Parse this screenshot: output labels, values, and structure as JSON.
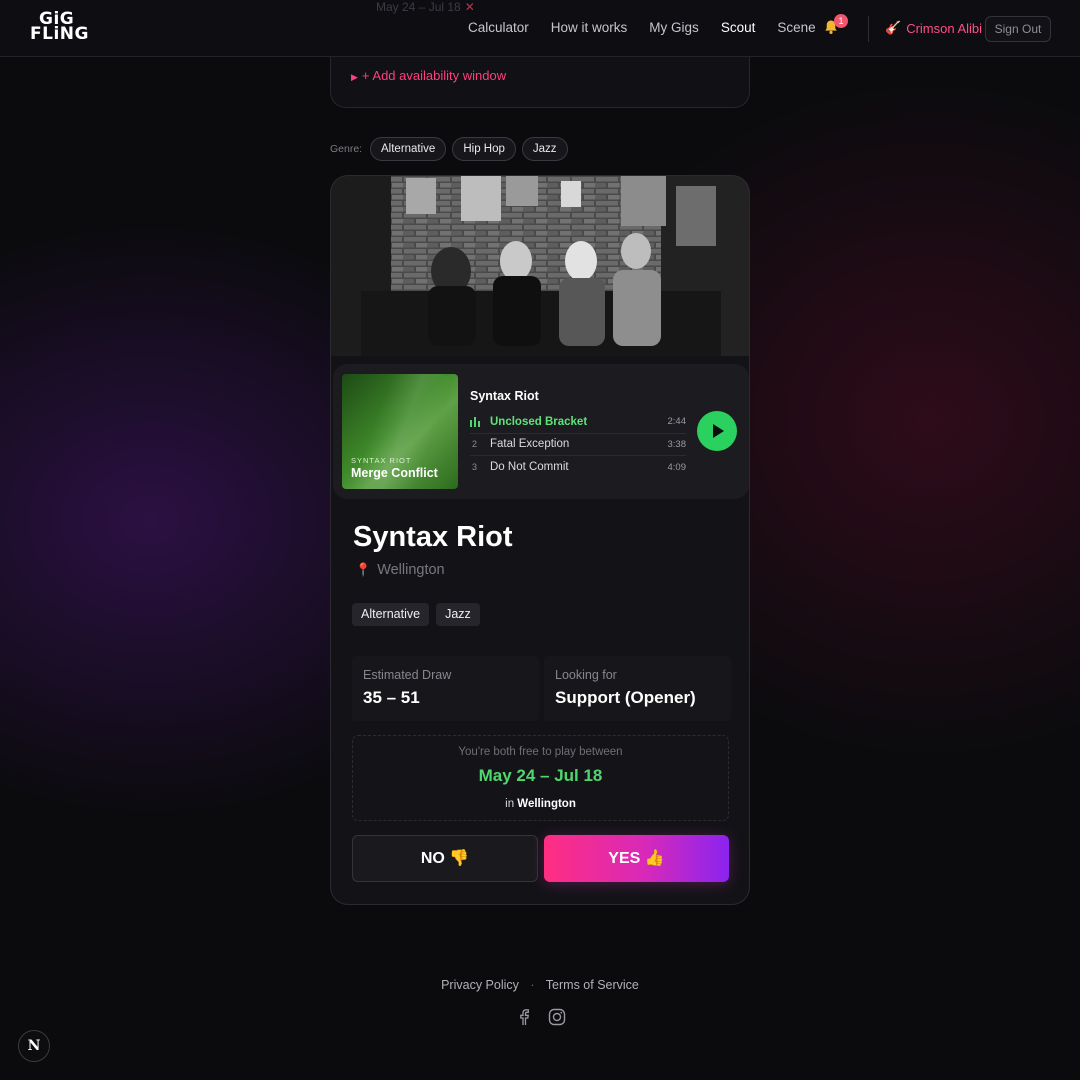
{
  "app": {
    "logo_line1": "GiG",
    "logo_line2": "FLiNG"
  },
  "nav": {
    "items": [
      {
        "label": "Calculator"
      },
      {
        "label": "How it works"
      },
      {
        "label": "My Gigs"
      },
      {
        "label": "Scout",
        "active": true
      },
      {
        "label": "Scene"
      }
    ],
    "notifications_count": "1",
    "user_name": "Crimson Alibi",
    "sign_out": "Sign Out"
  },
  "availability": {
    "ghost_range": "May 24 – Jul 18",
    "add_window_label": "+ Add availability window"
  },
  "filters": {
    "genre_label": "Genre:",
    "genres": [
      "Alternative",
      "Hip Hop",
      "Jazz"
    ]
  },
  "player": {
    "album_artist": "SYNTAX RIOT",
    "album_title": "Merge Conflict",
    "band": "Syntax Riot",
    "tracks": [
      {
        "num": "",
        "title": "Unclosed Bracket",
        "duration": "2:44",
        "playing": true
      },
      {
        "num": "2",
        "title": "Fatal Exception",
        "duration": "3:38"
      },
      {
        "num": "3",
        "title": "Do Not Commit",
        "duration": "4:09"
      }
    ]
  },
  "band": {
    "name": "Syntax Riot",
    "location": "Wellington",
    "tags": [
      "Alternative",
      "Jazz"
    ],
    "draw_label": "Estimated Draw",
    "draw_value": "35 – 51",
    "looking_label": "Looking for",
    "looking_value": "Support (Opener)"
  },
  "availability_match": {
    "caption": "You're both free to play between",
    "range": "May 24 – Jul 18",
    "prefix": "in",
    "place": "Wellington"
  },
  "actions": {
    "no": "NO 👎",
    "yes": "YES 👍"
  },
  "footer": {
    "privacy": "Privacy Policy",
    "separator": "·",
    "terms": "Terms of Service"
  },
  "dev_badge": "N",
  "colors": {
    "accent_pink": "#ff3f7c",
    "accent_green": "#4fd66e",
    "yes_gradient_end": "#8a24f0"
  }
}
